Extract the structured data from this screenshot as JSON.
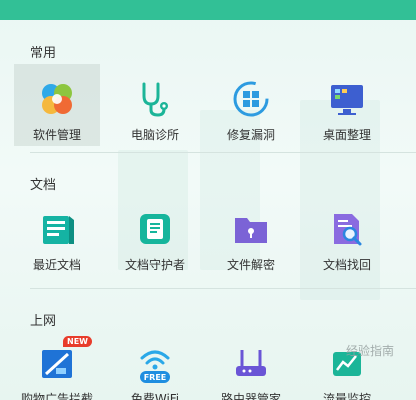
{
  "sections": [
    {
      "title": "常用",
      "items": [
        {
          "label": "软件管理",
          "icon": "software-manager-icon"
        },
        {
          "label": "电脑诊所",
          "icon": "stethoscope-icon"
        },
        {
          "label": "修复漏洞",
          "icon": "windows-repair-icon"
        },
        {
          "label": "桌面整理",
          "icon": "desktop-monitor-icon"
        }
      ]
    },
    {
      "title": "文档",
      "items": [
        {
          "label": "最近文档",
          "icon": "recent-docs-icon"
        },
        {
          "label": "文档守护者",
          "icon": "doc-guard-icon"
        },
        {
          "label": "文件解密",
          "icon": "folder-lock-icon"
        },
        {
          "label": "文档找回",
          "icon": "doc-search-icon"
        }
      ]
    },
    {
      "title": "上网",
      "items": [
        {
          "label": "购物广告拦截",
          "icon": "ad-block-icon",
          "badge": "NEW"
        },
        {
          "label": "免费WiFi",
          "icon": "free-wifi-icon",
          "badge_text": "FREE"
        },
        {
          "label": "路由器管家",
          "icon": "router-icon"
        },
        {
          "label": "流量监控",
          "icon": "traffic-monitor-icon"
        }
      ]
    }
  ],
  "watermark": "经验指南",
  "colors": {
    "topbar": "#32c096",
    "divider": "#d5e3df",
    "text": "#333333"
  }
}
